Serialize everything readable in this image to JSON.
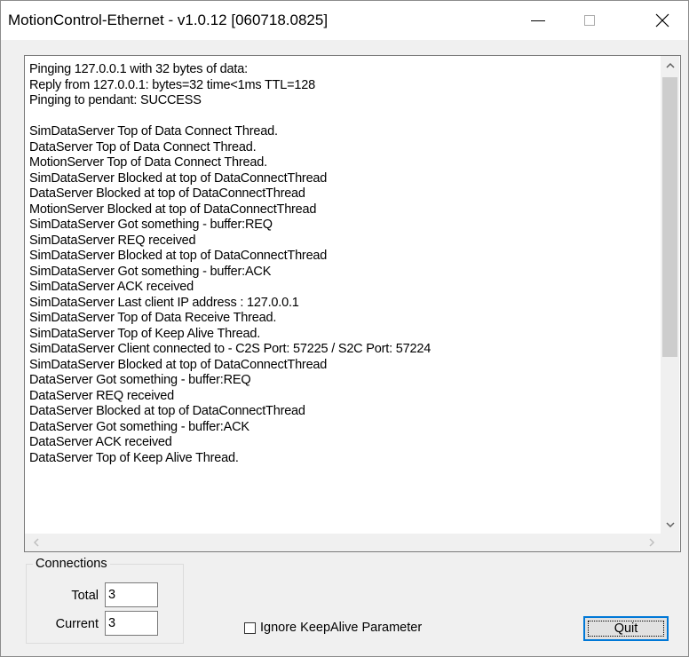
{
  "window": {
    "title": "MotionControl-Ethernet - v1.0.12 [060718.0825]"
  },
  "log": {
    "lines": [
      "Pinging 127.0.0.1 with 32 bytes of data:",
      "Reply from 127.0.0.1: bytes=32 time<1ms TTL=128",
      "Pinging to pendant: SUCCESS",
      "",
      "SimDataServer Top of Data Connect Thread.",
      "DataServer Top of Data Connect Thread.",
      "MotionServer Top of Data Connect Thread.",
      "SimDataServer Blocked at top of DataConnectThread",
      "DataServer Blocked at top of DataConnectThread",
      "MotionServer Blocked at top of DataConnectThread",
      "SimDataServer Got something - buffer:REQ",
      "SimDataServer REQ received",
      "SimDataServer Blocked at top of DataConnectThread",
      "SimDataServer Got something - buffer:ACK",
      "SimDataServer ACK received",
      "SimDataServer Last client IP address : 127.0.0.1",
      "SimDataServer Top of Data Receive Thread.",
      "SimDataServer Top of Keep Alive Thread.",
      "SimDataServer Client connected to - C2S Port: 57225 / S2C Port: 57224",
      "SimDataServer Blocked at top of DataConnectThread",
      "DataServer Got something - buffer:REQ",
      "DataServer REQ received",
      "DataServer Blocked at top of DataConnectThread",
      "DataServer Got something - buffer:ACK",
      "DataServer ACK received",
      "DataServer Top of Keep Alive Thread."
    ]
  },
  "connections": {
    "group_label": "Connections",
    "total_label": "Total",
    "total_value": "3",
    "current_label": "Current",
    "current_value": "3"
  },
  "options": {
    "ignore_keepalive_label": "Ignore KeepAlive Parameter",
    "ignore_keepalive_checked": false
  },
  "actions": {
    "quit_label": "Quit"
  },
  "colors": {
    "focus_border": "#0078d7",
    "window_bg": "#f0f0f0"
  }
}
